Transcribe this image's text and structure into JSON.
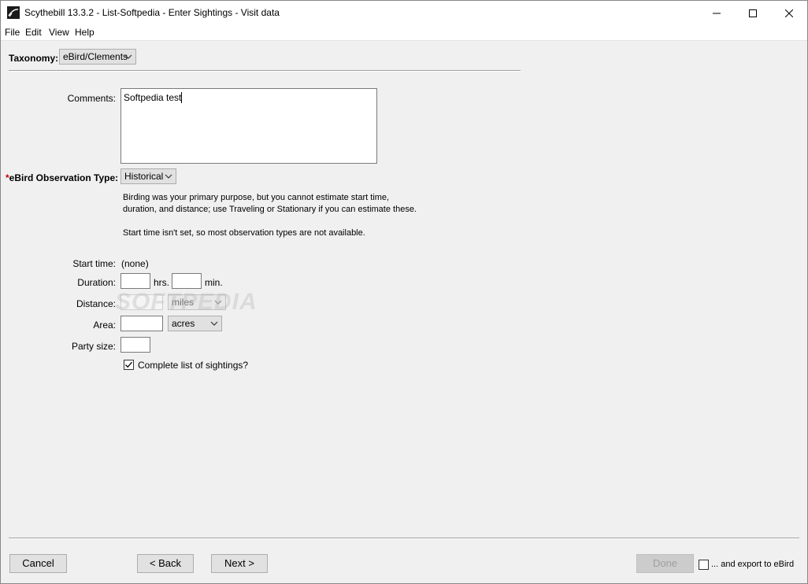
{
  "window": {
    "title": "Scythebill 13.3.2 - List-Softpedia - Enter Sightings - Visit data",
    "icons": {
      "app": "scythe-app-icon",
      "minimize": "minimize-icon",
      "maximize": "maximize-icon",
      "close": "close-icon"
    }
  },
  "menu": {
    "items": [
      "File",
      "Edit",
      "View",
      "Help"
    ]
  },
  "taxonomy": {
    "label": "Taxonomy:",
    "value": "eBird/Clements"
  },
  "comments": {
    "label": "Comments:",
    "value": "Softpedia test"
  },
  "observation": {
    "required_marker": "*",
    "label": "eBird Observation Type:",
    "value": "Historical",
    "description_line1": "Birding was your primary purpose, but you cannot estimate start time,",
    "description_line2": "duration, and distance; use Traveling or Stationary if you can estimate these.",
    "note": "Start time isn't set, so most observation types are not available."
  },
  "start_time": {
    "label": "Start time:",
    "value": "(none)"
  },
  "duration": {
    "label": "Duration:",
    "hours_unit": "hrs.",
    "minutes_unit": "min.",
    "hours": "",
    "minutes": ""
  },
  "distance": {
    "label": "Distance:",
    "value": "",
    "unit": "miles"
  },
  "area": {
    "label": "Area:",
    "value": "",
    "unit": "acres"
  },
  "party_size": {
    "label": "Party size:",
    "value": ""
  },
  "complete_list": {
    "label": "Complete list of sightings?",
    "checked": true
  },
  "watermark": "SOFTPEDIA",
  "footer": {
    "cancel": "Cancel",
    "back": "< Back",
    "next": "Next >",
    "done": "Done",
    "export_label": "... and export to eBird",
    "export_checked": false
  },
  "colors": {
    "required": "#cc0000",
    "window_bg": "#f0f0f0",
    "button_bg": "#e1e1e1"
  }
}
